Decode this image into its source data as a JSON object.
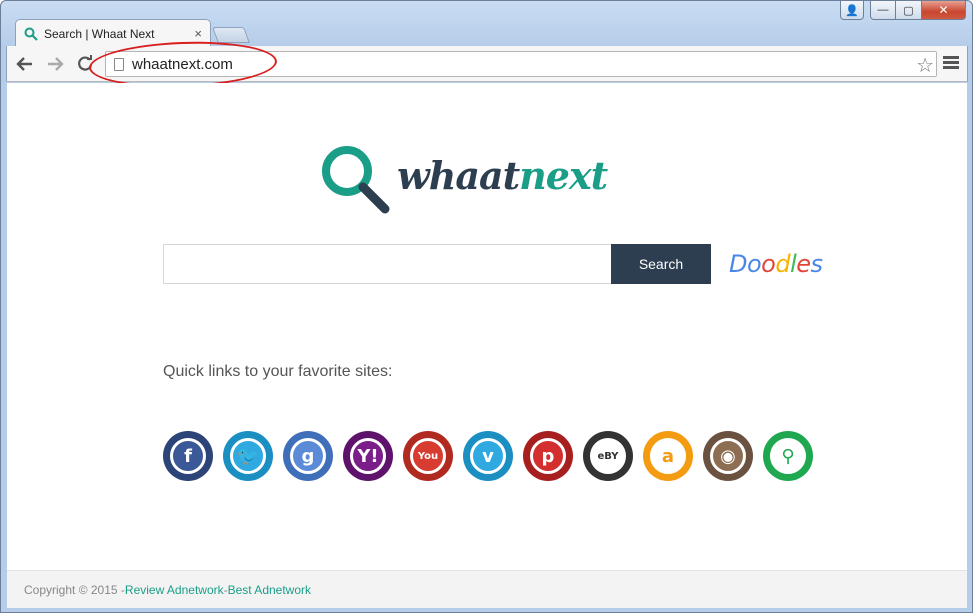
{
  "browser": {
    "tab_title": "Search | Whaat Next",
    "tab_close": "×",
    "url": "whaatnext.com",
    "window_buttons": {
      "user": "👤",
      "minimize": "—",
      "maximize": "▢",
      "close": "✕"
    }
  },
  "page": {
    "logo": {
      "word1": "whaat",
      "word2": "next"
    },
    "search": {
      "input_value": "",
      "button_label": "Search"
    },
    "doodles": [
      "D",
      "o",
      "o",
      "d",
      "l",
      "e",
      "s"
    ],
    "quick_links_label": "Quick links to your favorite sites:",
    "quick_links": [
      {
        "name": "facebook",
        "glyph": "f",
        "color": "#3b5998",
        "ring": "#2c4478"
      },
      {
        "name": "twitter",
        "glyph": "🐦",
        "color": "#2fa9e0",
        "ring": "#1b8fc2"
      },
      {
        "name": "google",
        "glyph": "g",
        "color": "#5b8bd6",
        "ring": "#3f6fb8"
      },
      {
        "name": "yahoo",
        "glyph": "Y!",
        "color": "#7b1e8a",
        "ring": "#5f126c"
      },
      {
        "name": "youtube",
        "glyph": "You",
        "color": "#d83b2f",
        "ring": "#b02a20"
      },
      {
        "name": "vimeo",
        "glyph": "v",
        "color": "#2fa9e0",
        "ring": "#1b8fc2"
      },
      {
        "name": "pinterest",
        "glyph": "p",
        "color": "#d32f2f",
        "ring": "#a81f1f"
      },
      {
        "name": "ebay",
        "glyph": "eBY",
        "color": "#ffffff",
        "ring": "#333333"
      },
      {
        "name": "amazon",
        "glyph": "a",
        "color": "#ffffff",
        "ring": "#f39c12"
      },
      {
        "name": "instagram",
        "glyph": "◉",
        "color": "#8d6e53",
        "ring": "#6b5240"
      },
      {
        "name": "whaatnext",
        "glyph": "⚲",
        "color": "#ffffff",
        "ring": "#1fa850"
      }
    ],
    "footer": {
      "copyright": "Copyright © 2015 - ",
      "link1": "Review Adnetwork",
      "sep": " - ",
      "link2": "Best Adnetwork"
    }
  },
  "colors": {
    "brand_dark": "#2c3e50",
    "brand_teal": "#1a9e88",
    "annotation": "#d81e1e"
  }
}
